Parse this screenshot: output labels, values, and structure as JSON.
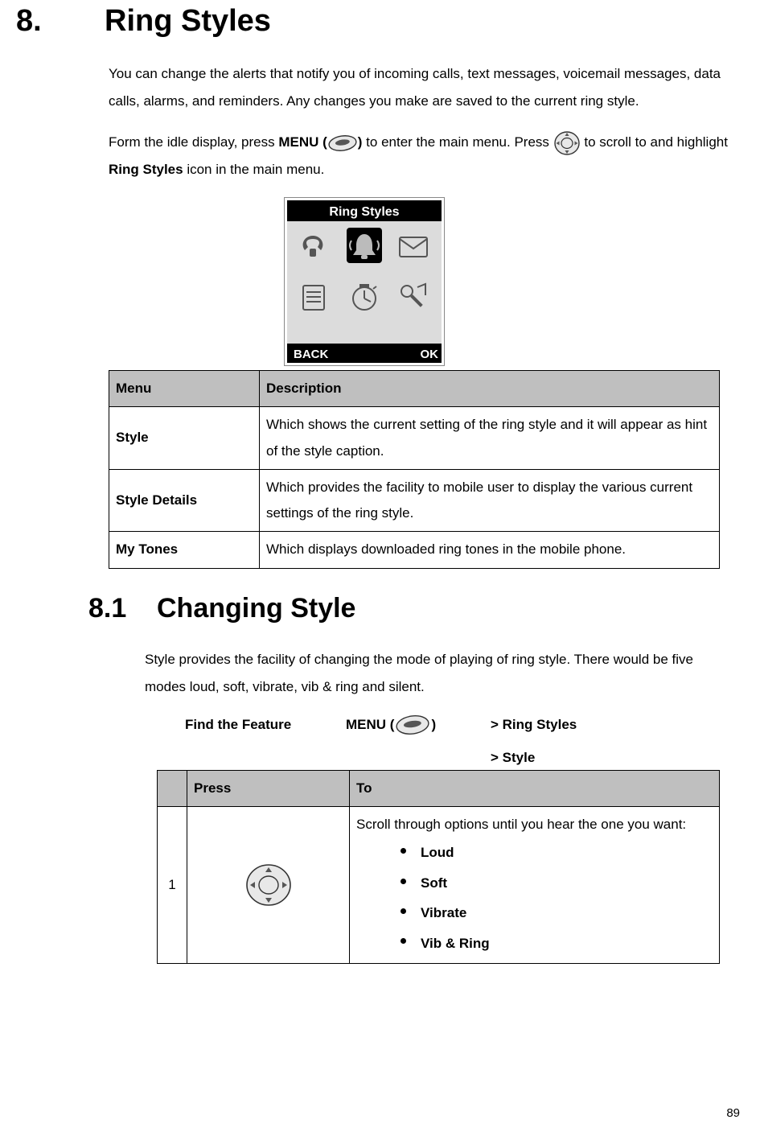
{
  "section": {
    "number": "8.",
    "title": "Ring Styles",
    "intro1": "You can change the alerts that notify you of incoming calls, text messages, voicemail messages, data calls, alarms, and reminders. Any changes you make are saved to the current ring style.",
    "intro2a": "Form the idle display, press ",
    "intro2_menu": "MENU (",
    "intro2_menu_close": ")",
    "intro2b": " to enter the main menu. Press ",
    "intro2c": " to scroll to and highlight ",
    "intro2_ringstyles": "Ring Styles",
    "intro2d": " icon in the main menu."
  },
  "screenshot": {
    "title": "Ring Styles",
    "softkey_left": "BACK",
    "softkey_right": "OK"
  },
  "menu_table": {
    "headers": {
      "col1": "Menu",
      "col2": "Description"
    },
    "rows": [
      {
        "label": "Style",
        "desc": "Which shows the current setting of the ring style and it will appear as hint of the style caption."
      },
      {
        "label": "Style Details",
        "desc": "Which provides the facility to mobile user to display the various current settings of the ring style."
      },
      {
        "label": "My Tones",
        "desc": "Which displays downloaded ring tones in the mobile phone."
      }
    ]
  },
  "subsection": {
    "number": "8.1",
    "title": "Changing Style",
    "body": "Style provides the facility of changing the mode of playing of ring style. There would be five modes loud, soft, vibrate, vib & ring and silent.",
    "feature": {
      "label": "Find the Feature",
      "menu": "MENU (",
      "menu_close": ")",
      "path1": "> Ring Styles",
      "path2": "> Style"
    }
  },
  "press_table": {
    "headers": {
      "num": "",
      "press": "Press",
      "to": "To"
    },
    "row1": {
      "num": "1",
      "to_intro": "Scroll through options until you hear the one you want:",
      "options": [
        "Loud",
        "Soft",
        "Vibrate",
        "Vib & Ring"
      ]
    }
  },
  "page_number": "89"
}
